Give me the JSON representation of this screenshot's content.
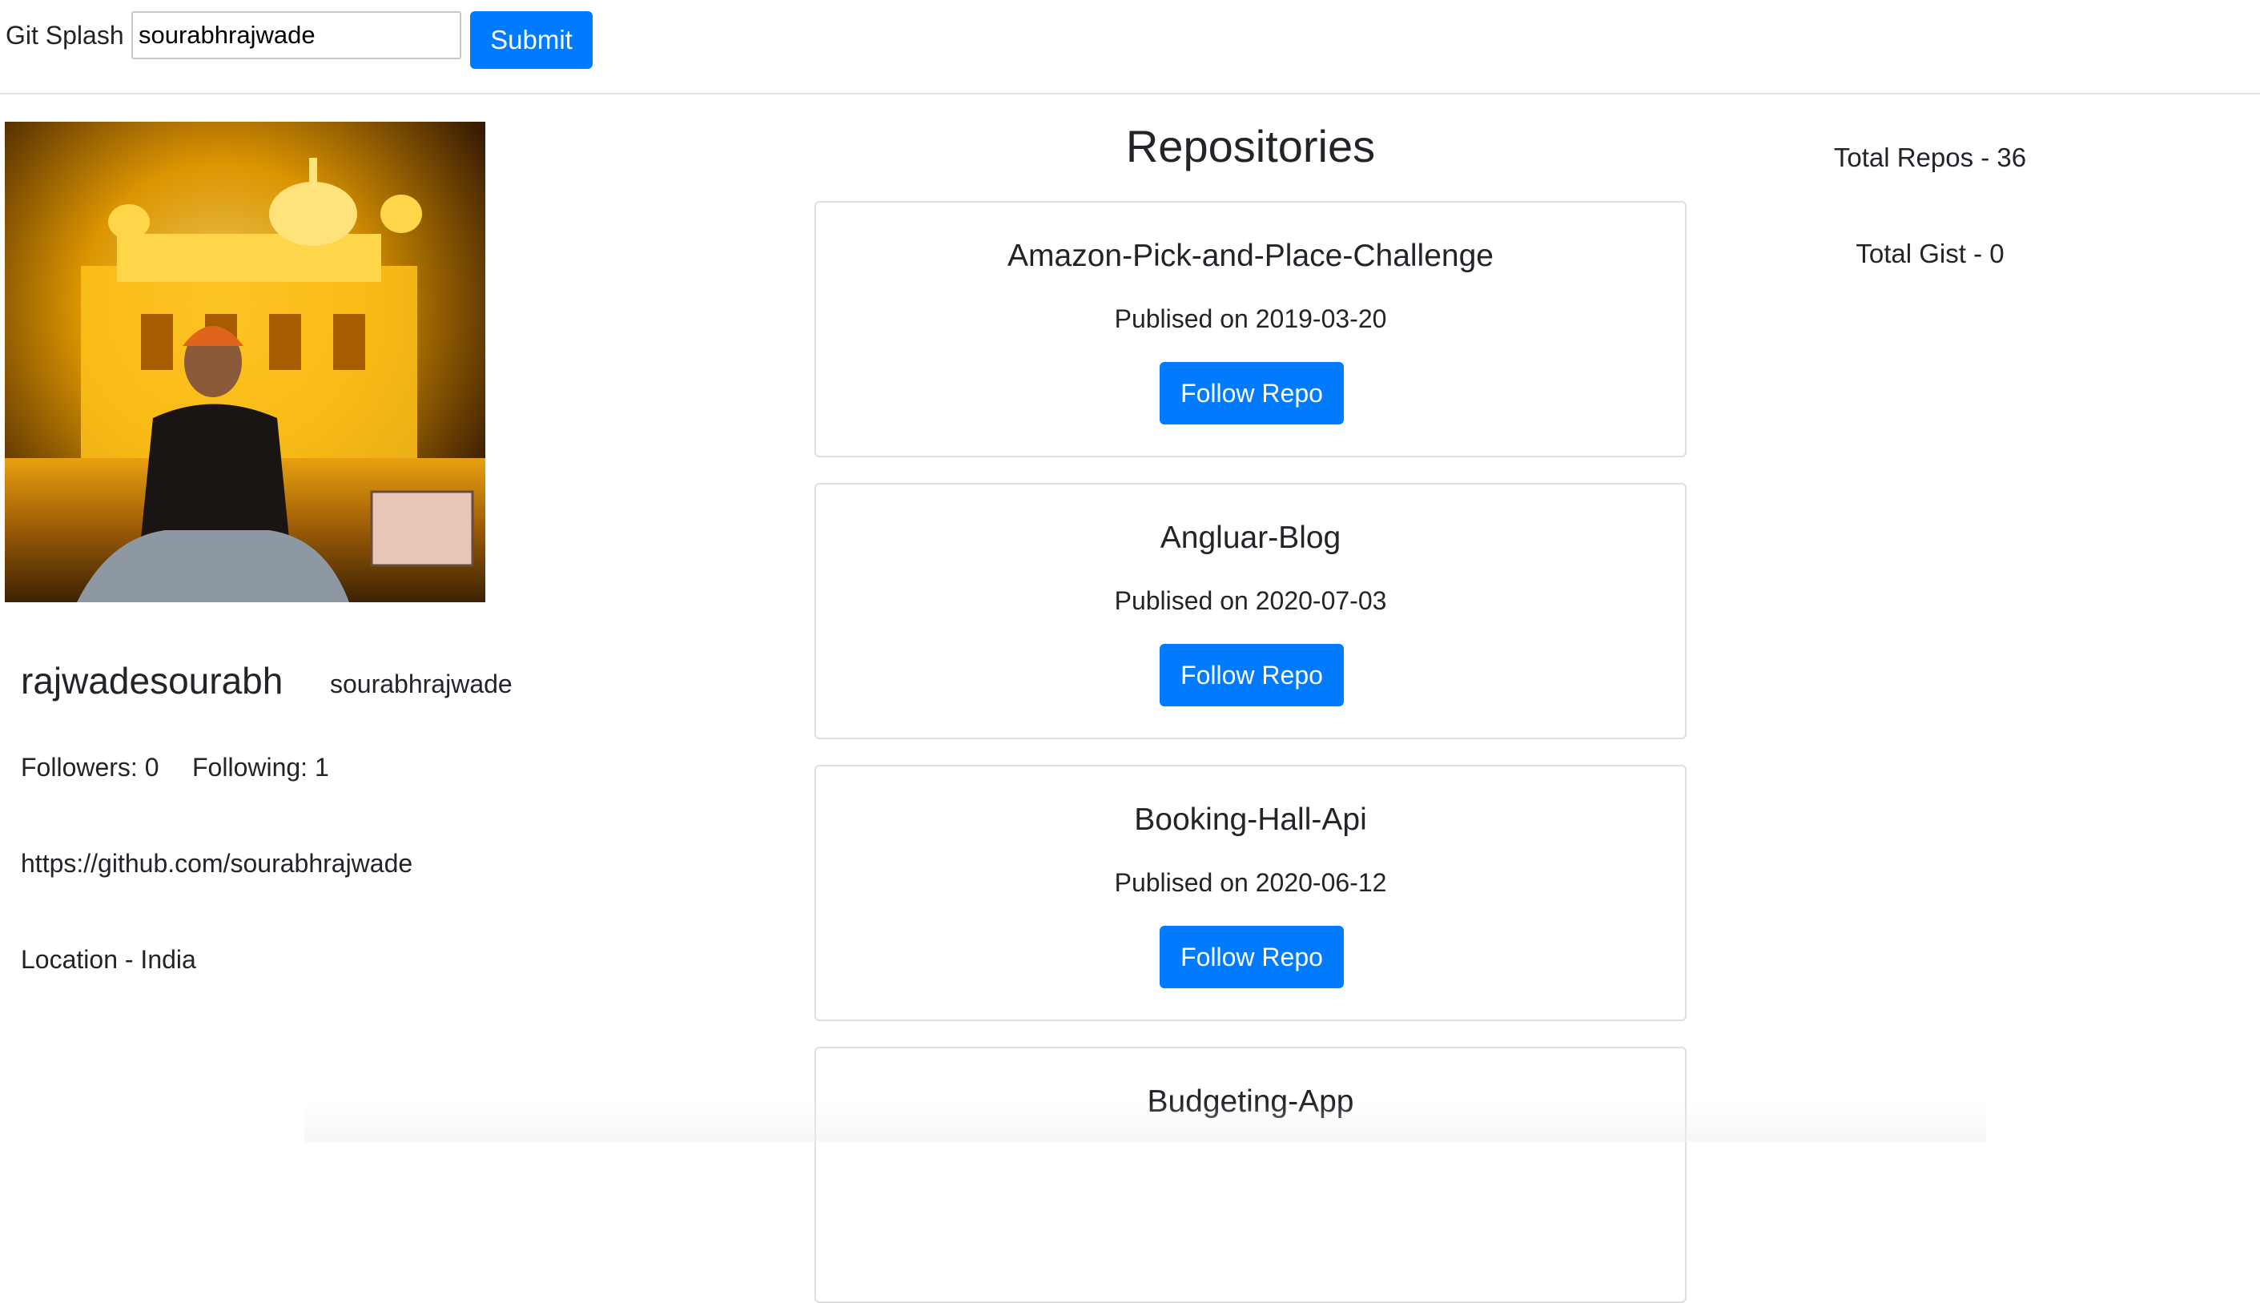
{
  "header": {
    "brand": "Git Splash",
    "search_value": "sourabhrajwade",
    "submit_label": "Submit"
  },
  "profile": {
    "name": "rajwadesourabh",
    "login": "sourabhrajwade",
    "followers": "Followers: 0",
    "following": "Following: 1",
    "url": "https://github.com/sourabhrajwade",
    "location": "Location - India"
  },
  "repositories": {
    "heading": "Repositories",
    "items": [
      {
        "name": "Amazon-Pick-and-Place-Challenge",
        "published": "Publised on 2019-03-20",
        "button": "Follow Repo"
      },
      {
        "name": "Angluar-Blog",
        "published": "Publised on 2020-07-03",
        "button": "Follow Repo"
      },
      {
        "name": "Booking-Hall-Api",
        "published": "Publised on 2020-06-12",
        "button": "Follow Repo"
      },
      {
        "name": "Budgeting-App",
        "published": "",
        "button": ""
      }
    ]
  },
  "stats": {
    "total_repos": "Total Repos - 36",
    "total_gist": "Total Gist - 0"
  },
  "colors": {
    "primary": "#007bff",
    "text": "#212529",
    "border": "#dfdfdf"
  }
}
